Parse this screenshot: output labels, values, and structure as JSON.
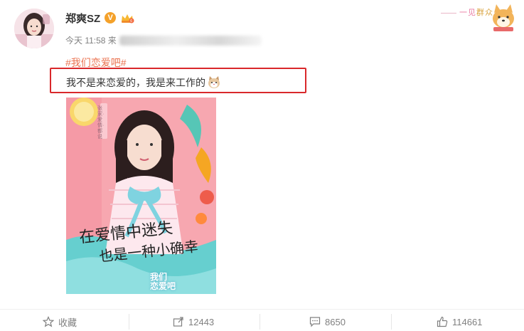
{
  "user": {
    "name": "郑爽SZ",
    "verified_badge": "V",
    "post_time": "今天 11:58 来"
  },
  "post": {
    "hashtag": "#我们恋爱吧#",
    "text": "我不是来恋爱的，我是来工作的",
    "emoji": "cat-face-emoji"
  },
  "poster": {
    "side_text": "张家·爱情·都说",
    "slogan_line1": "在爱情中迷失",
    "slogan_line2": "也是一种小确幸",
    "logo_line1": "我们",
    "logo_line2": "恋爱吧"
  },
  "fan_sticker": {
    "text_a": "一见",
    "text_b": "群众"
  },
  "actions": {
    "favorite_label": "收藏",
    "repost_count": "12443",
    "comment_count": "8650",
    "like_count": "114661"
  },
  "colors": {
    "hashtag": "#eb7350",
    "highlight_box": "#d9282b",
    "verified": "#f4a12a",
    "muted": "#808080"
  }
}
